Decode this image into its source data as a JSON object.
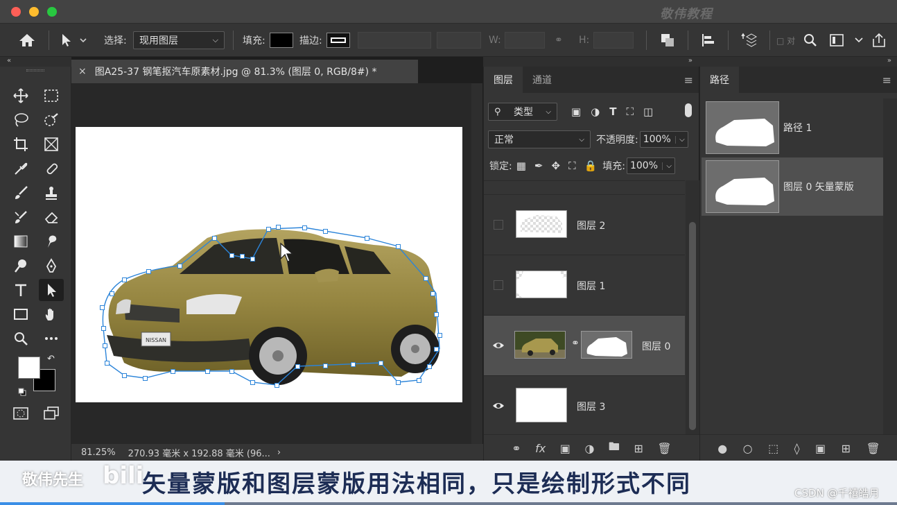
{
  "watermark_top": "敬伟教程",
  "options": {
    "select_label": "选择:",
    "select_value": "现用图层",
    "fill_label": "填充:",
    "stroke_label": "描边:",
    "w_label": "W:",
    "h_label": "H:"
  },
  "document": {
    "tab_title": "图A25-37 钢笔抠汽车原素材.jpg @ 81.3% (图层 0, RGB/8#) *",
    "zoom": "81.25%",
    "dimensions": "270.93 毫米 x 192.88 毫米 (96..."
  },
  "layers_panel": {
    "tab_layers": "图层",
    "tab_channels": "通道",
    "filter": "类型",
    "blend_mode": "正常",
    "opacity_label": "不透明度:",
    "opacity_value": "100%",
    "lock_label": "锁定:",
    "fill_label": "填充:",
    "fill_value": "100%",
    "layers": [
      {
        "name": "图层 2",
        "visible": false
      },
      {
        "name": "图层 1",
        "visible": false
      },
      {
        "name": "图层 0",
        "visible": true,
        "selected": true
      },
      {
        "name": "图层 3",
        "visible": true
      }
    ],
    "footer_icons": [
      "link-icon",
      "fx-icon",
      "mask-icon",
      "adjustment-icon",
      "folder-icon",
      "new-layer-icon",
      "trash-icon"
    ],
    "fx_label": "fx"
  },
  "paths_panel": {
    "tab": "路径",
    "paths": [
      {
        "name": "路径 1"
      },
      {
        "name": "图层 0 矢量蒙版",
        "selected": true
      }
    ]
  },
  "overlay": {
    "author": "敬伟先生",
    "subtitle": "矢量蒙版和图层蒙版用法相同，只是绘制形式不同",
    "csdn": "CSDN @千禧皓月",
    "progress": 0.25
  },
  "colors": {
    "accent": "#2b84d9",
    "foreground": "#ffffff",
    "background": "#000000",
    "car": "#9a8a48"
  }
}
